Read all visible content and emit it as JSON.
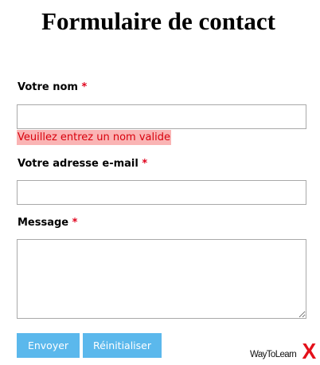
{
  "form": {
    "title": "Formulaire de contact",
    "required_marker": "*",
    "name_field": {
      "label": "Votre nom",
      "value": "",
      "error": "Veuillez entrez un nom valide"
    },
    "email_field": {
      "label": "Votre adresse e-mail",
      "value": ""
    },
    "message_field": {
      "label": "Message",
      "value": ""
    },
    "buttons": {
      "submit_label": "Envoyer",
      "reset_label": "Réinitialiser"
    }
  },
  "brand": {
    "text": "WayToLearn",
    "x": "X"
  },
  "colors": {
    "required": "#e0001b",
    "error_text": "#d8000c",
    "error_bg": "#fab4b4",
    "button_bg": "#5bb8ec",
    "brand_x": "#e4101a"
  }
}
